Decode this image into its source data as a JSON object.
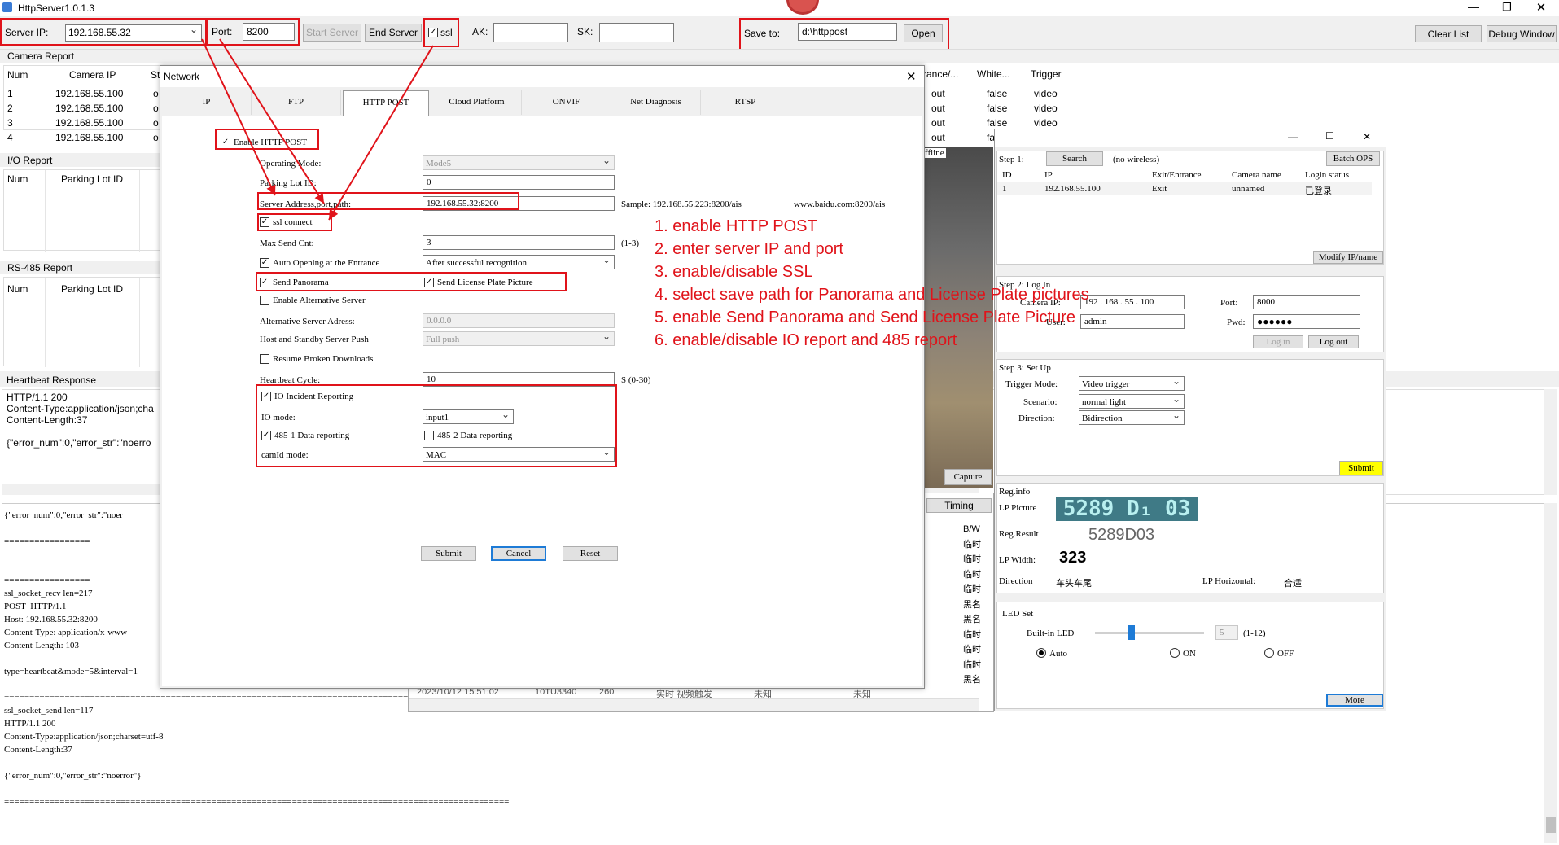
{
  "window": {
    "title": "HttpServer1.0.1.3"
  },
  "toolbar": {
    "server_ip_label": "Server IP:",
    "server_ip_value": "192.168.55.32",
    "port_label": "Port:",
    "port_value": "8200",
    "start_server": "Start Server",
    "end_server": "End Server",
    "ssl_label": "ssl",
    "ak_label": "AK:",
    "sk_label": "SK:",
    "save_to_label": "Save to:",
    "save_to_value": "d:\\httppost",
    "open": "Open",
    "clear_list": "Clear List",
    "debug_window": "Debug Window"
  },
  "camera_report": {
    "title": "Camera Report",
    "columns": [
      "Num",
      "Camera IP",
      "St"
    ],
    "right_columns": [
      "rance/...",
      "White...",
      "Trigger"
    ],
    "rows": [
      {
        "num": "1",
        "ip": "192.168.55.100",
        "st": "o",
        "entrance": "out",
        "white": "false",
        "trigger": "video"
      },
      {
        "num": "2",
        "ip": "192.168.55.100",
        "st": "o",
        "entrance": "out",
        "white": "false",
        "trigger": "video"
      },
      {
        "num": "3",
        "ip": "192.168.55.100",
        "st": "o",
        "entrance": "out",
        "white": "false",
        "trigger": "video"
      },
      {
        "num": "4",
        "ip": "192.168.55.100",
        "st": "o",
        "entrance": "out",
        "white": "false",
        "trigger": "video"
      }
    ]
  },
  "io_report": {
    "title": "I/O Report",
    "columns": [
      "Num",
      "Parking Lot ID"
    ]
  },
  "rs485_report": {
    "title": "RS-485 Report",
    "columns": [
      "Num",
      "Parking Lot ID"
    ]
  },
  "heartbeat": {
    "title": "Heartbeat Response",
    "lines": [
      "HTTP/1.1 200",
      "Content-Type:application/json;cha",
      "Content-Length:37",
      "",
      "{\"error_num\":0,\"error_str\":\"noerro"
    ]
  },
  "log": {
    "lines": [
      "{\"error_num\":0,\"error_str\":\"noer",
      "",
      "=================",
      "",
      "",
      "=================",
      "ssl_socket_recv len=217",
      "POST  HTTP/1.1",
      "Host: 192.168.55.32:8200",
      "Content-Type: application/x-www-",
      "Content-Length: 103",
      "",
      "type=heartbeat&mode=5&interval=1",
      "",
      "====================================================================================================================================",
      "ssl_socket_send len=117",
      "HTTP/1.1 200",
      "Content-Type:application/json;charset=utf-8",
      "Content-Length:37",
      "",
      "{\"error_num\":0,\"error_str\":\"noerror\"}",
      "",
      "===================================================================================================="
    ]
  },
  "bottom_list": {
    "row": {
      "time": "2023/10/12 15:51:02",
      "plate": "10TU3340",
      "n": "260",
      "mode": "实时 视频触发",
      "a": "未知",
      "b": "未知"
    },
    "timing": "Timing",
    "side_col": [
      "B/W",
      "临时",
      "临时",
      "临时",
      "临时",
      "黑名",
      "黑名",
      "临时",
      "临时",
      "临时",
      "黑名"
    ]
  },
  "dialog": {
    "title": "Network",
    "tabs": [
      "IP",
      "FTP",
      "HTTP POST",
      "Cloud Platform",
      "ONVIF",
      "Net Diagnosis",
      "RTSP"
    ],
    "active_tab": "HTTP POST",
    "enable_http_post": "Enable HTTP POST",
    "operating_mode_label": "Operating Mode:",
    "operating_mode_value": "Mode5",
    "parking_lot_label": "Parking Lot ID:",
    "parking_lot_value": "0",
    "server_addr_label": "Server Address,port,path:",
    "server_addr_value": "192.168.55.32:8200",
    "sample_label": "Sample: 192.168.55.223:8200/ais",
    "sample_label2": "www.baidu.com:8200/ais",
    "ssl_connect": "ssl connect",
    "max_send_label": "Max Send Cnt:",
    "max_send_value": "3",
    "max_send_range": "(1-3)",
    "auto_open_label": "Auto Opening at the Entrance",
    "auto_open_value": "After successful recognition",
    "send_panorama": "Send Panorama",
    "send_plate": "Send License Plate Picture",
    "enable_alt_server": "Enable Alternative Server",
    "alt_server_label": "Alternative Server Adress:",
    "alt_server_value": "0.0.0.0",
    "host_standby_label": "Host and Standby Server Push",
    "host_standby_value": "Full push",
    "resume_broken": "Resume Broken Downloads",
    "heartbeat_label": "Heartbeat Cycle:",
    "heartbeat_value": "10",
    "heartbeat_range": "S (0-30)",
    "io_incident": "IO Incident Reporting",
    "io_mode_label": "IO mode:",
    "io_mode_value": "input1",
    "rs485_1": "485-1 Data reporting",
    "rs485_2": "485-2 Data reporting",
    "camid_label": "camId mode:",
    "camid_value": "MAC",
    "submit": "Submit",
    "cancel": "Cancel",
    "reset": "Reset"
  },
  "annotations": [
    "1. enable HTTP POST",
    "2. enter server IP and port",
    "3. enable/disable SSL",
    "4. select save path for Panorama and License Plate pictures",
    "5. enable Send Panorama and Send License Plate Picture",
    "6. enable/disable IO report and 485 report"
  ],
  "client": {
    "offline_label": "ffline",
    "capture": "Capture",
    "step1_label": "Step 1:",
    "search": "Search",
    "no_wireless": "(no wireless)",
    "batch_ops": "Batch OPS",
    "table_columns": [
      "ID",
      "IP",
      "Exit/Entrance",
      "Camera name",
      "Login status"
    ],
    "table_row": {
      "id": "1",
      "ip": "192.168.55.100",
      "exit": "Exit",
      "name": "unnamed",
      "status": "已登录"
    },
    "modify_ip": "Modify IP/name",
    "step2_label": "Step 2: Log In",
    "camera_ip_label": "Camera IP:",
    "camera_ip_value": "192 . 168 . 55 . 100",
    "port_label": "Port:",
    "port_value": "8000",
    "user_label": "User:",
    "user_value": "admin",
    "pwd_label": "Pwd:",
    "pwd_value": "●●●●●●",
    "log_in": "Log in",
    "log_out": "Log out",
    "step3_label": "Step 3: Set Up",
    "trigger_label": "Trigger Mode:",
    "trigger_value": "Video trigger",
    "scenario_label": "Scenario:",
    "scenario_value": "normal light",
    "direction_label": "Direction:",
    "direction_value": "Bidirection",
    "submit": "Submit",
    "reg_info": "Reg.info",
    "lp_picture": "LP Picture",
    "plate_image_text": "5289 D₁ 03",
    "reg_result_label": "Reg.Result",
    "reg_result_value": "5289D03",
    "lp_width_label": "LP Width:",
    "lp_width_value": "323",
    "direction2_label": "Direction",
    "direction2_value": "车头车尾",
    "lp_horizontal_label": "LP Horizontal:",
    "lp_horizontal_value": "合适",
    "led_set": "LED Set",
    "builtin_led": "Built-in LED",
    "led_value": "5",
    "led_range": "(1-12)",
    "led_level_percent": 30,
    "radio_auto": "Auto",
    "radio_on": "ON",
    "radio_off": "OFF",
    "more": "More"
  },
  "colors": {
    "annotation_red": "#e0131a",
    "submit_yellow": "#ffff00",
    "plate_bg": "#3f7a86"
  }
}
